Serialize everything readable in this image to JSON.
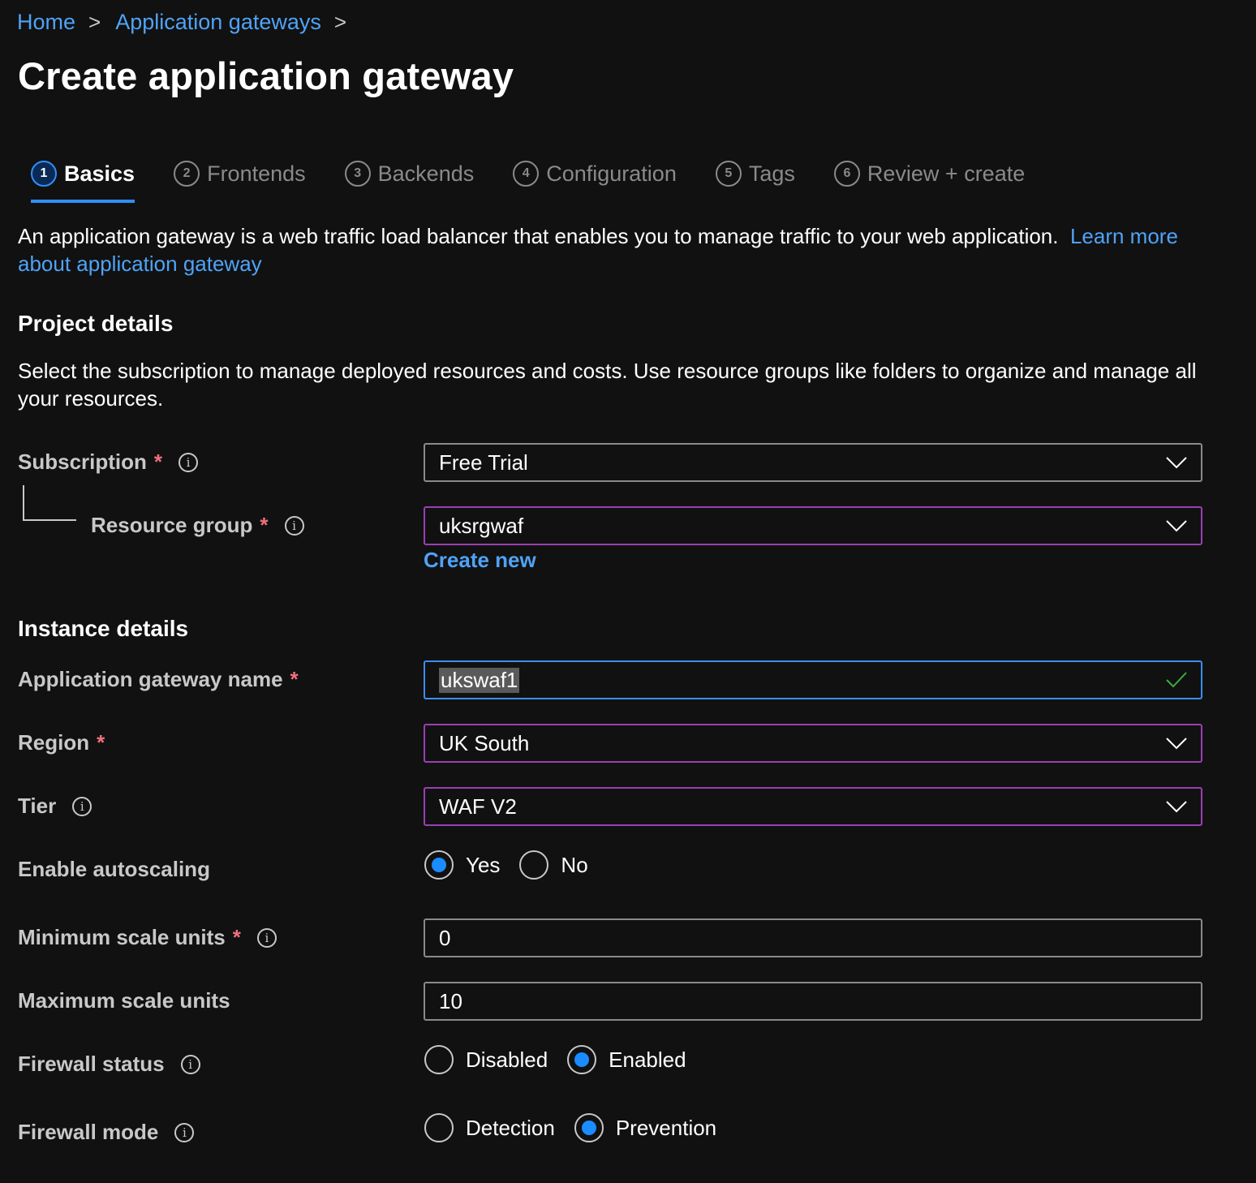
{
  "breadcrumb": {
    "home": "Home",
    "app_gateways": "Application gateways",
    "sep": ">"
  },
  "page_title": "Create application gateway",
  "tabs": [
    {
      "num": "1",
      "label": "Basics"
    },
    {
      "num": "2",
      "label": "Frontends"
    },
    {
      "num": "3",
      "label": "Backends"
    },
    {
      "num": "4",
      "label": "Configuration"
    },
    {
      "num": "5",
      "label": "Tags"
    },
    {
      "num": "6",
      "label": "Review + create"
    }
  ],
  "active_tab": "Basics",
  "intro": {
    "text": "An application gateway is a web traffic load balancer that enables you to manage traffic to your web application.",
    "link": "Learn more about application gateway"
  },
  "project": {
    "heading": "Project details",
    "description": "Select the subscription to manage deployed resources and costs. Use resource groups like folders to organize and manage all your resources.",
    "subscription_label": "Subscription",
    "subscription_value": "Free Trial",
    "resource_group_label": "Resource group",
    "resource_group_value": "uksrgwaf",
    "create_new": "Create new"
  },
  "instance": {
    "heading": "Instance details",
    "name_label": "Application gateway name",
    "name_value": "ukswaf1",
    "region_label": "Region",
    "region_value": "UK South",
    "tier_label": "Tier",
    "tier_value": "WAF V2",
    "autoscaling_label": "Enable autoscaling",
    "autoscaling_options": [
      "Yes",
      "No"
    ],
    "autoscaling_selected": "Yes",
    "min_label": "Minimum scale units",
    "min_value": "0",
    "max_label": "Maximum scale units",
    "max_value": "10",
    "firewall_status_label": "Firewall status",
    "firewall_status_options": [
      "Disabled",
      "Enabled"
    ],
    "firewall_status_selected": "Enabled",
    "firewall_mode_label": "Firewall mode",
    "firewall_mode_options": [
      "Detection",
      "Prevention"
    ],
    "firewall_mode_selected": "Prevention"
  },
  "required_marker": "*",
  "info_glyph": "i",
  "colors": {
    "link": "#4fa3f7",
    "accent": "#2f8fff",
    "required": "#f1707b",
    "invalid_border": "#9b3fb3",
    "valid_check": "#3fae3a"
  }
}
